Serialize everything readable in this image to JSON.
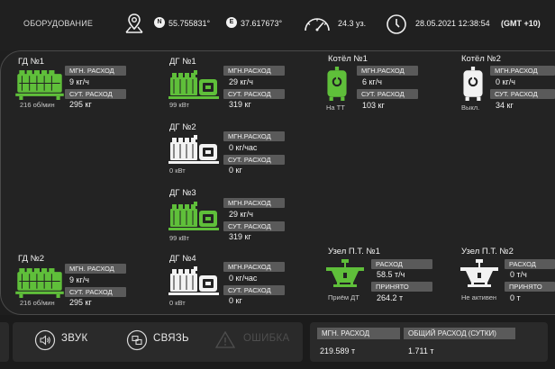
{
  "header": {
    "title": "ОБОРУДОВАНИЕ",
    "lat_letter": "N",
    "latitude": "55.755831°",
    "lon_letter": "E",
    "longitude": "37.617673°",
    "speed": "24.3 уз.",
    "datetime": "28.05.2021   12:38:54",
    "timezone": "(GMT +10)"
  },
  "gd1": {
    "title": "ГД №1",
    "l1": "МГН. РАСХОД",
    "v1": "9 кг/ч",
    "l2": "СУТ. РАСХОД",
    "v2": "295 кг",
    "sub": "216 об/мин"
  },
  "gd2": {
    "title": "ГД №2",
    "l1": "МГН. РАСХОД",
    "v1": "9 кг/ч",
    "l2": "СУТ. РАСХОД",
    "v2": "295 кг",
    "sub": "216 об/мин"
  },
  "dg1": {
    "title": "ДГ №1",
    "l1": "МГН.РАСХОД",
    "v1": "29 кг/ч",
    "l2": "СУТ. РАСХОД",
    "v2": "319 кг",
    "sub": "99   кВт"
  },
  "dg2": {
    "title": "ДГ №2",
    "l1": "МГН.РАСХОД",
    "v1": "0 кг/час",
    "l2": "СУТ. РАСХОД",
    "v2": "0 кг",
    "sub": "0 кВт"
  },
  "dg3": {
    "title": "ДГ №3",
    "l1": "МГН.РАСХОД",
    "v1": "29 кг/ч",
    "l2": "СУТ. РАСХОД",
    "v2": "319 кг",
    "sub": "99   кВт"
  },
  "dg4": {
    "title": "ДГ №4",
    "l1": "МГН.РАСХОД",
    "v1": "0 кг/час",
    "l2": "СУТ. РАСХОД",
    "v2": "0 кг",
    "sub": "0 кВт"
  },
  "boiler1": {
    "title": "Котёл №1",
    "l1": "МГН.РАСХОД",
    "v1": "6 кг/ч",
    "l2": "СУТ. РАСХОД",
    "v2": "103 кг",
    "sub": "На ТТ"
  },
  "boiler2": {
    "title": "Котёл №2",
    "l1": "МГН.РАСХОД",
    "v1": "0 кг/ч",
    "l2": "СУТ. РАСХОД",
    "v2": "34 кг",
    "sub": "Выкл."
  },
  "node1": {
    "title": "Узел П.Т. №1",
    "l1": "РАСХОД",
    "v1": "58.5 т/ч",
    "l2": "ПРИНЯТО",
    "v2": "264.2 т",
    "sub": "Приём ДТ"
  },
  "node2": {
    "title": "Узел П.Т. №2",
    "l1": "РАСХОД",
    "v1": "0 т/ч",
    "l2": "ПРИНЯТО",
    "v2": "0 т",
    "sub": "Не активен"
  },
  "footer": {
    "sound": "ЗВУК",
    "link": "СВЯЗЬ",
    "error": "ОШИБКА",
    "inst_label": "МГН. РАСХОД",
    "inst_value": "219.589 т",
    "total_label": "ОБЩИЙ РАСХОД (СУТКИ)",
    "total_value": "1.711 т"
  },
  "colors": {
    "active": "#5fbf3a",
    "inactive": "#f2f2f2",
    "label_bg": "#5a5a5a",
    "background": "#1e1e1e"
  },
  "icons": [
    "map-pin-icon",
    "speedometer-icon",
    "clock-icon",
    "engine-icon",
    "generator-icon",
    "boiler-icon",
    "fuel-node-icon",
    "speaker-icon",
    "link-icon",
    "warning-icon"
  ]
}
